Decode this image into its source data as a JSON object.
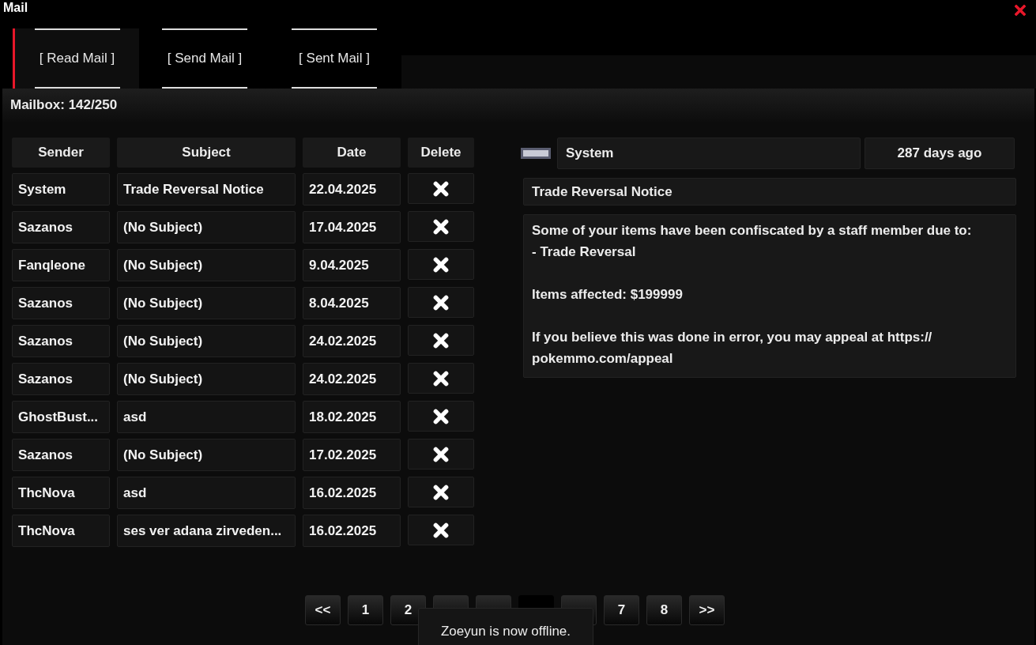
{
  "window": {
    "title": "Mail"
  },
  "tabs": [
    {
      "label": "[ Read Mail ]",
      "selected": true
    },
    {
      "label": "[ Send Mail ]",
      "selected": false
    },
    {
      "label": "[ Sent Mail ]",
      "selected": false
    }
  ],
  "mailbox": {
    "label": "Mailbox: 142/250"
  },
  "table": {
    "columns": [
      "Sender",
      "Subject",
      "Date",
      "Delete"
    ],
    "rows": [
      {
        "sender": "System",
        "subject": "Trade Reversal Notice",
        "date": "22.04.2025"
      },
      {
        "sender": "Sazanos",
        "subject": "(No Subject)",
        "date": "17.04.2025"
      },
      {
        "sender": "Fanqleone",
        "subject": "(No Subject)",
        "date": "9.04.2025"
      },
      {
        "sender": "Sazanos",
        "subject": "(No Subject)",
        "date": "8.04.2025"
      },
      {
        "sender": "Sazanos",
        "subject": "(No Subject)",
        "date": "24.02.2025"
      },
      {
        "sender": "Sazanos",
        "subject": "(No Subject)",
        "date": "24.02.2025"
      },
      {
        "sender": "GhostBust...",
        "subject": "asd",
        "date": "18.02.2025"
      },
      {
        "sender": "Sazanos",
        "subject": "(No Subject)",
        "date": "17.02.2025"
      },
      {
        "sender": "ThcNova",
        "subject": "asd",
        "date": "16.02.2025"
      },
      {
        "sender": "ThcNova",
        "subject": "ses ver adana zirveden...",
        "date": "16.02.2025"
      }
    ]
  },
  "message": {
    "sender": "System",
    "age": "287 days  ago",
    "subject": "Trade Reversal Notice",
    "paragraphs": [
      "Some of your items have been confiscated by a staff member due to:\n- Trade Reversal",
      "Items affected: $199999",
      "If you believe this was done in error, you may appeal at https:// pokemmo.com/appeal"
    ]
  },
  "pagination": [
    {
      "label": "<<",
      "selected": false
    },
    {
      "label": "1",
      "selected": false
    },
    {
      "label": "2",
      "selected": false
    },
    {
      "selected": false
    },
    {
      "selected": false
    },
    {
      "selected": true
    },
    {
      "selected": false
    },
    {
      "label": "7",
      "selected": false
    },
    {
      "label": "8",
      "selected": false
    },
    {
      "label": ">>",
      "selected": false
    }
  ],
  "toast": {
    "text": "Zoeyun is now offline."
  }
}
